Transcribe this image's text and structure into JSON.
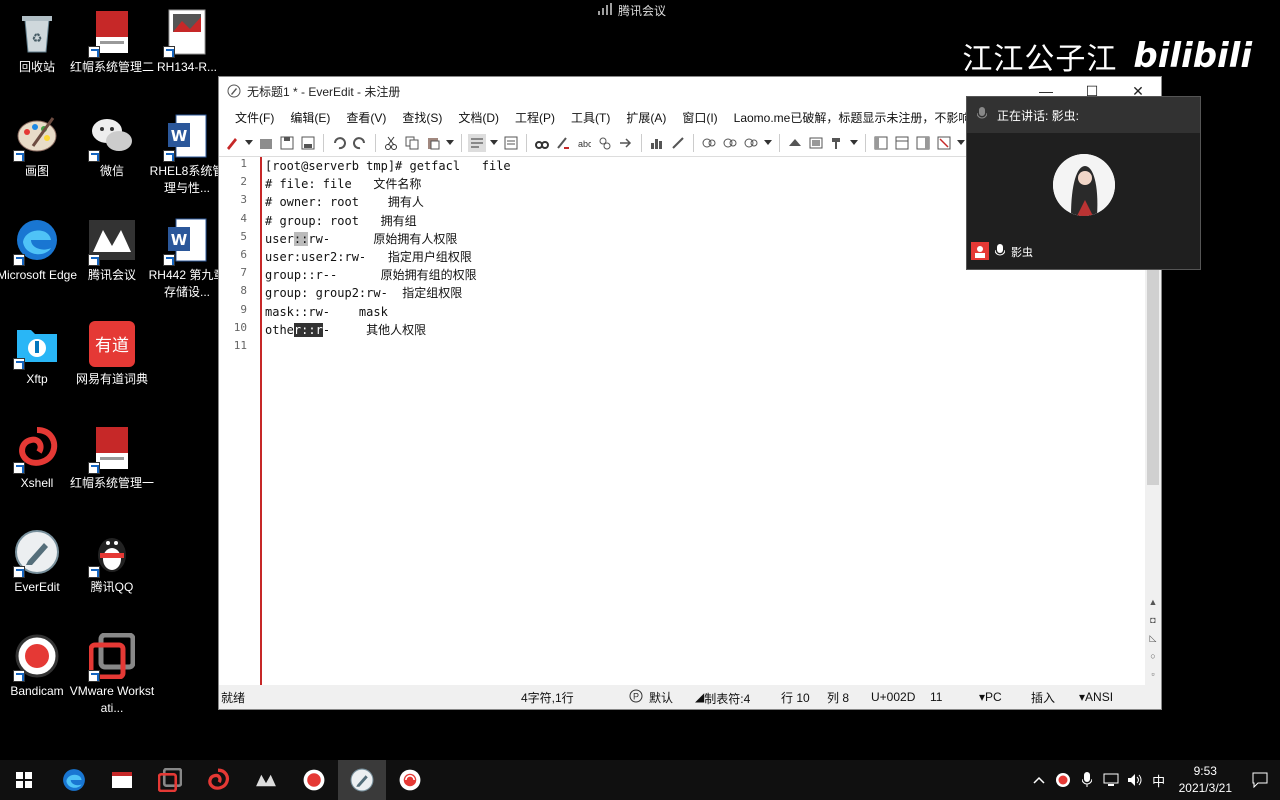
{
  "desktop": {
    "icons": [
      {
        "label": "回收站"
      },
      {
        "label": "红帽系统管理二"
      },
      {
        "label": "RH134-R..."
      },
      {
        "label": "画图"
      },
      {
        "label": "微信"
      },
      {
        "label": "RHEL8系统管理与性..."
      },
      {
        "label": "Microsoft Edge"
      },
      {
        "label": "腾讯会议"
      },
      {
        "label": "RH442 第九章 存储设..."
      },
      {
        "label": "Xftp"
      },
      {
        "label": "网易有道词典"
      },
      {
        "label": "Xshell"
      },
      {
        "label": "红帽系统管理一"
      },
      {
        "label": "EverEdit"
      },
      {
        "label": "腾讯QQ"
      },
      {
        "label": "Bandicam"
      },
      {
        "label": "VMware Workstati..."
      }
    ]
  },
  "meeting_bar": {
    "title": "腾讯会议"
  },
  "watermark": {
    "text1": "江江公子江",
    "text2": "bilibili"
  },
  "editor": {
    "title": "无标题1 * - EverEdit - 未注册",
    "menu": [
      "文件(F)",
      "编辑(E)",
      "查看(V)",
      "查找(S)",
      "文档(D)",
      "工程(P)",
      "工具(T)",
      "扩展(A)",
      "窗口(I)",
      "Laomo.me已破解，标题显示未注册，不影响"
    ],
    "line_numbers": [
      "1",
      "2",
      "3",
      "4",
      "5",
      "6",
      "7",
      "8",
      "9",
      "10",
      "11"
    ],
    "lines": {
      "l1": "[root@serverb tmp]# getfacl   file",
      "l2": "# file: file   文件名称",
      "l3": "# owner: root    拥有人",
      "l4": "# group: root   拥有组",
      "l5a": "user",
      "l5b": ":",
      "l5c": ":",
      "l5d": "rw-      原始拥有人权限",
      "l6": "user:user2:rw-   指定用户组权限",
      "l7": "group::r--      原始拥有组的权限",
      "l8": "group: group2:rw-  指定组权限",
      "l9": "mask::rw-    mask",
      "l10a": "othe",
      "l10b": "r::r",
      "l10c": "-     其他人权限",
      "l11": ""
    },
    "status": {
      "ready": "就绪",
      "selection": "4字符,1行",
      "mode": "默认",
      "tab": "制表符:4",
      "row": "行 10",
      "col": "列 8",
      "unicode": "U+002D",
      "value": "11",
      "eol": "PC",
      "insert": "插入",
      "encoding": "ANSI"
    }
  },
  "meeting_panel": {
    "speaking": "正在讲话: 影虫:",
    "user": "影虫"
  },
  "taskbar": {
    "ime": "中",
    "time": "9:53",
    "date": "2021/3/21"
  },
  "colors": {
    "accent_red": "#c62828",
    "taskbar": "#101010"
  }
}
